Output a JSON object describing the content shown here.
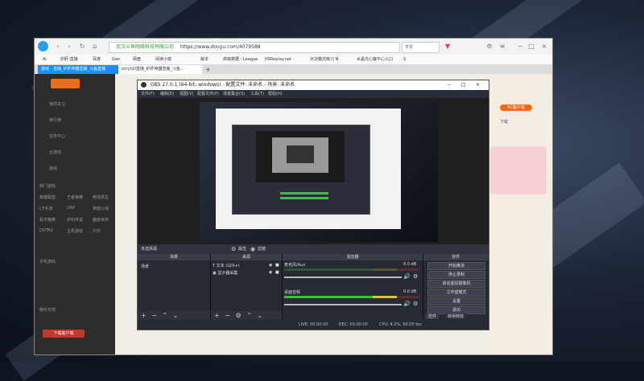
{
  "browser": {
    "url_site": "武汉斗鱼网络科技有限公司",
    "url": "https://www.douyu.com/4079588",
    "search_label": "岁月",
    "bookmarks": [
      "Ai",
      "护肝-直播",
      "百度",
      "Goo",
      "网盘",
      "阅读小窗",
      "版本",
      "高级数据 - League",
      "HSReplay.net -",
      "对决模式练习 N",
      "水晶光心魔平心入口",
      "S"
    ],
    "tabs": [
      {
        "label": "游戏 - 直播_护肝神器直播_斗鱼直播"
      },
      {
        "label": "onlyhill直播_护肝神器直播_斗鱼..."
      }
    ],
    "new_tab": "+"
  },
  "sidebar": {
    "items": [
      "我的关注",
      "排行榜",
      "任务中心",
      "云游戏",
      "游戏"
    ],
    "section_title": "热门游戏",
    "games": [
      "英雄联盟",
      "王者荣耀",
      "绝地求生",
      "CF手游",
      "DNF",
      "穿越火线",
      "和平精英",
      "炉石传说",
      "魔兽世界",
      "DOTA2",
      "主机游戏",
      "户外"
    ],
    "section2": "手机游戏",
    "section3": "娱乐天地",
    "bottom_button": "下载客户端"
  },
  "obs": {
    "title": "OBS 27.0.1 (64-bit, windows) - 配置文件: 未命名 - 场景: 未命名",
    "menu": [
      "文件(F)",
      "编辑(E)",
      "视图(V)",
      "配置文件(P)",
      "场景集合(S)",
      "工具(T)",
      "帮助(H)"
    ],
    "source_status": "未选择源",
    "props_btn": "属性",
    "filters_btn": "滤镜",
    "docks": {
      "scenes": {
        "title": "场景",
        "items": [
          "场景"
        ]
      },
      "sources": {
        "title": "来源",
        "items": [
          "文本 (GDI+)",
          "显示器采集"
        ]
      },
      "mixer": {
        "title": "混音器",
        "channels": [
          {
            "name": "麦克风/Aux",
            "db": "0.0 dB"
          },
          {
            "name": "桌面音频",
            "db": "0.0 dB"
          }
        ]
      },
      "controls": {
        "title": "控件",
        "buttons": [
          "开始推流",
          "停止录制",
          "启动虚拟摄像机",
          "工作室模式",
          "设置",
          "退出"
        ],
        "tabs": [
          "控件",
          "转场特效"
        ]
      }
    },
    "status": {
      "live": "LIVE: 00:00:00",
      "rec": "REC: 00:00:00",
      "cpu": "CPU: 4.2%, 60.00 fps"
    }
  },
  "page_right": {
    "items": [
      "PC客户端",
      "下载"
    ]
  },
  "icons": [
    "back-icon",
    "forward-icon",
    "refresh-icon",
    "home-icon",
    "shield-icon",
    "gear-icon",
    "close-icon",
    "minimize-icon",
    "maximize-icon",
    "speaker-icon",
    "add-icon",
    "remove-icon",
    "up-icon",
    "down-icon",
    "eye-icon",
    "lock-icon"
  ],
  "colors": {
    "obs_bg": "#2b2e38",
    "accent": "#ff6a00",
    "meter_green": "#3cbf3c",
    "meter_yellow": "#d2c53b",
    "meter_red": "#c23b3b"
  }
}
